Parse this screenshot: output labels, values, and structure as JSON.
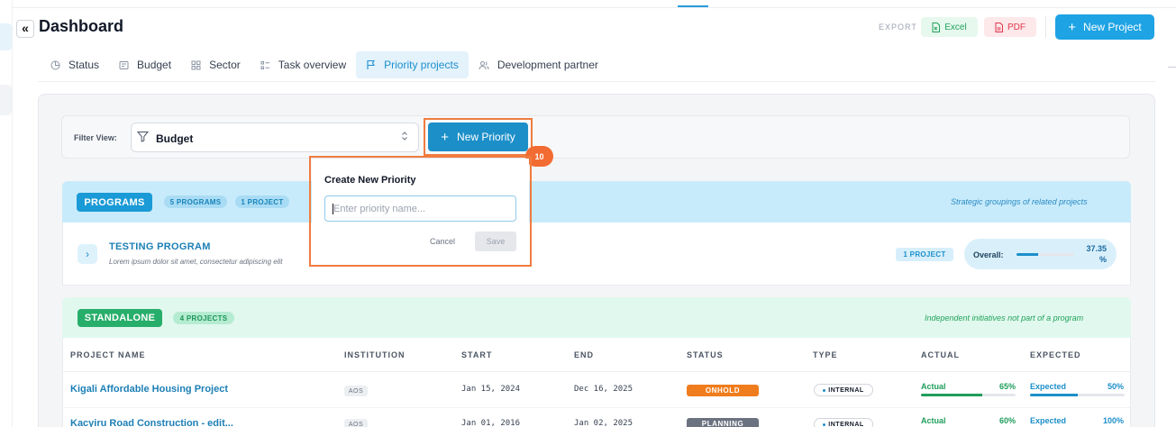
{
  "header": {
    "collapse_icon": "double-chevron-left-icon",
    "title": "Dashboard",
    "export_label": "EXPORT",
    "excel_label": "Excel",
    "pdf_label": "PDF",
    "new_project_label": "New Project"
  },
  "tabs": [
    {
      "label": "Status",
      "icon": "pie-chart-icon"
    },
    {
      "label": "Budget",
      "icon": "budget-icon"
    },
    {
      "label": "Sector",
      "icon": "grid-icon"
    },
    {
      "label": "Task overview",
      "icon": "list-icon"
    },
    {
      "label": "Priority projects",
      "icon": "flag-icon",
      "active": true
    },
    {
      "label": "Development partner",
      "icon": "users-icon"
    }
  ],
  "filter": {
    "label": "Filter View:",
    "value": "Budget",
    "new_priority_label": "New Priority",
    "step_number": "10"
  },
  "popover": {
    "title": "Create New Priority",
    "input_value": "",
    "input_placeholder": "Enter priority name...",
    "cancel_label": "Cancel",
    "save_label": "Save"
  },
  "programs": {
    "badge": "PROGRAMS",
    "count_programs": "5 PROGRAMS",
    "count_projects": "1 PROJECT",
    "note": "Strategic groupings of related projects",
    "item": {
      "name": "TESTING PROGRAM",
      "description": "Lorem ipsum dolor sit amet, consectetur adipiscing elit",
      "project_count": "1 PROJECT",
      "overall_label": "Overall:",
      "overall_value": "37.35 %",
      "overall_fraction": 0.3735
    }
  },
  "standalone": {
    "badge": "STANDALONE",
    "count_projects": "4 PROJECTS",
    "note": "Independent initiatives not part of a program",
    "columns": [
      "PROJECT NAME",
      "INSTITUTION",
      "START",
      "END",
      "STATUS",
      "TYPE",
      "ACTUAL",
      "EXPECTED"
    ],
    "rows": [
      {
        "name": "Kigali Affordable Housing Project",
        "institution": "AOS",
        "start": "Jan 15, 2024",
        "end": "Dec 16, 2025",
        "status": "ONHOLD",
        "status_color": "#f07d1d",
        "type": "INTERNAL",
        "actual_label": "Actual",
        "actual_pct": "65%",
        "actual_fraction": 0.65,
        "expected_label": "Expected",
        "expected_pct": "50%",
        "expected_fraction": 0.5
      },
      {
        "name": "Kacyiru Road Construction - edit...",
        "institution": "AOS",
        "start": "Jan 01, 2016",
        "end": "Jan 02, 2025",
        "status": "PLANNING",
        "status_color": "#6b7280",
        "type": "INTERNAL",
        "actual_label": "Actual",
        "actual_pct": "60%",
        "actual_fraction": 0.6,
        "expected_label": "Expected",
        "expected_pct": "100%",
        "expected_fraction": 1.0
      }
    ]
  },
  "colors": {
    "accent": "#1ea3e4",
    "highlight": "#f07c3f",
    "actual_green": "#1f9d5b",
    "expected_blue": "#1c8fc9"
  }
}
